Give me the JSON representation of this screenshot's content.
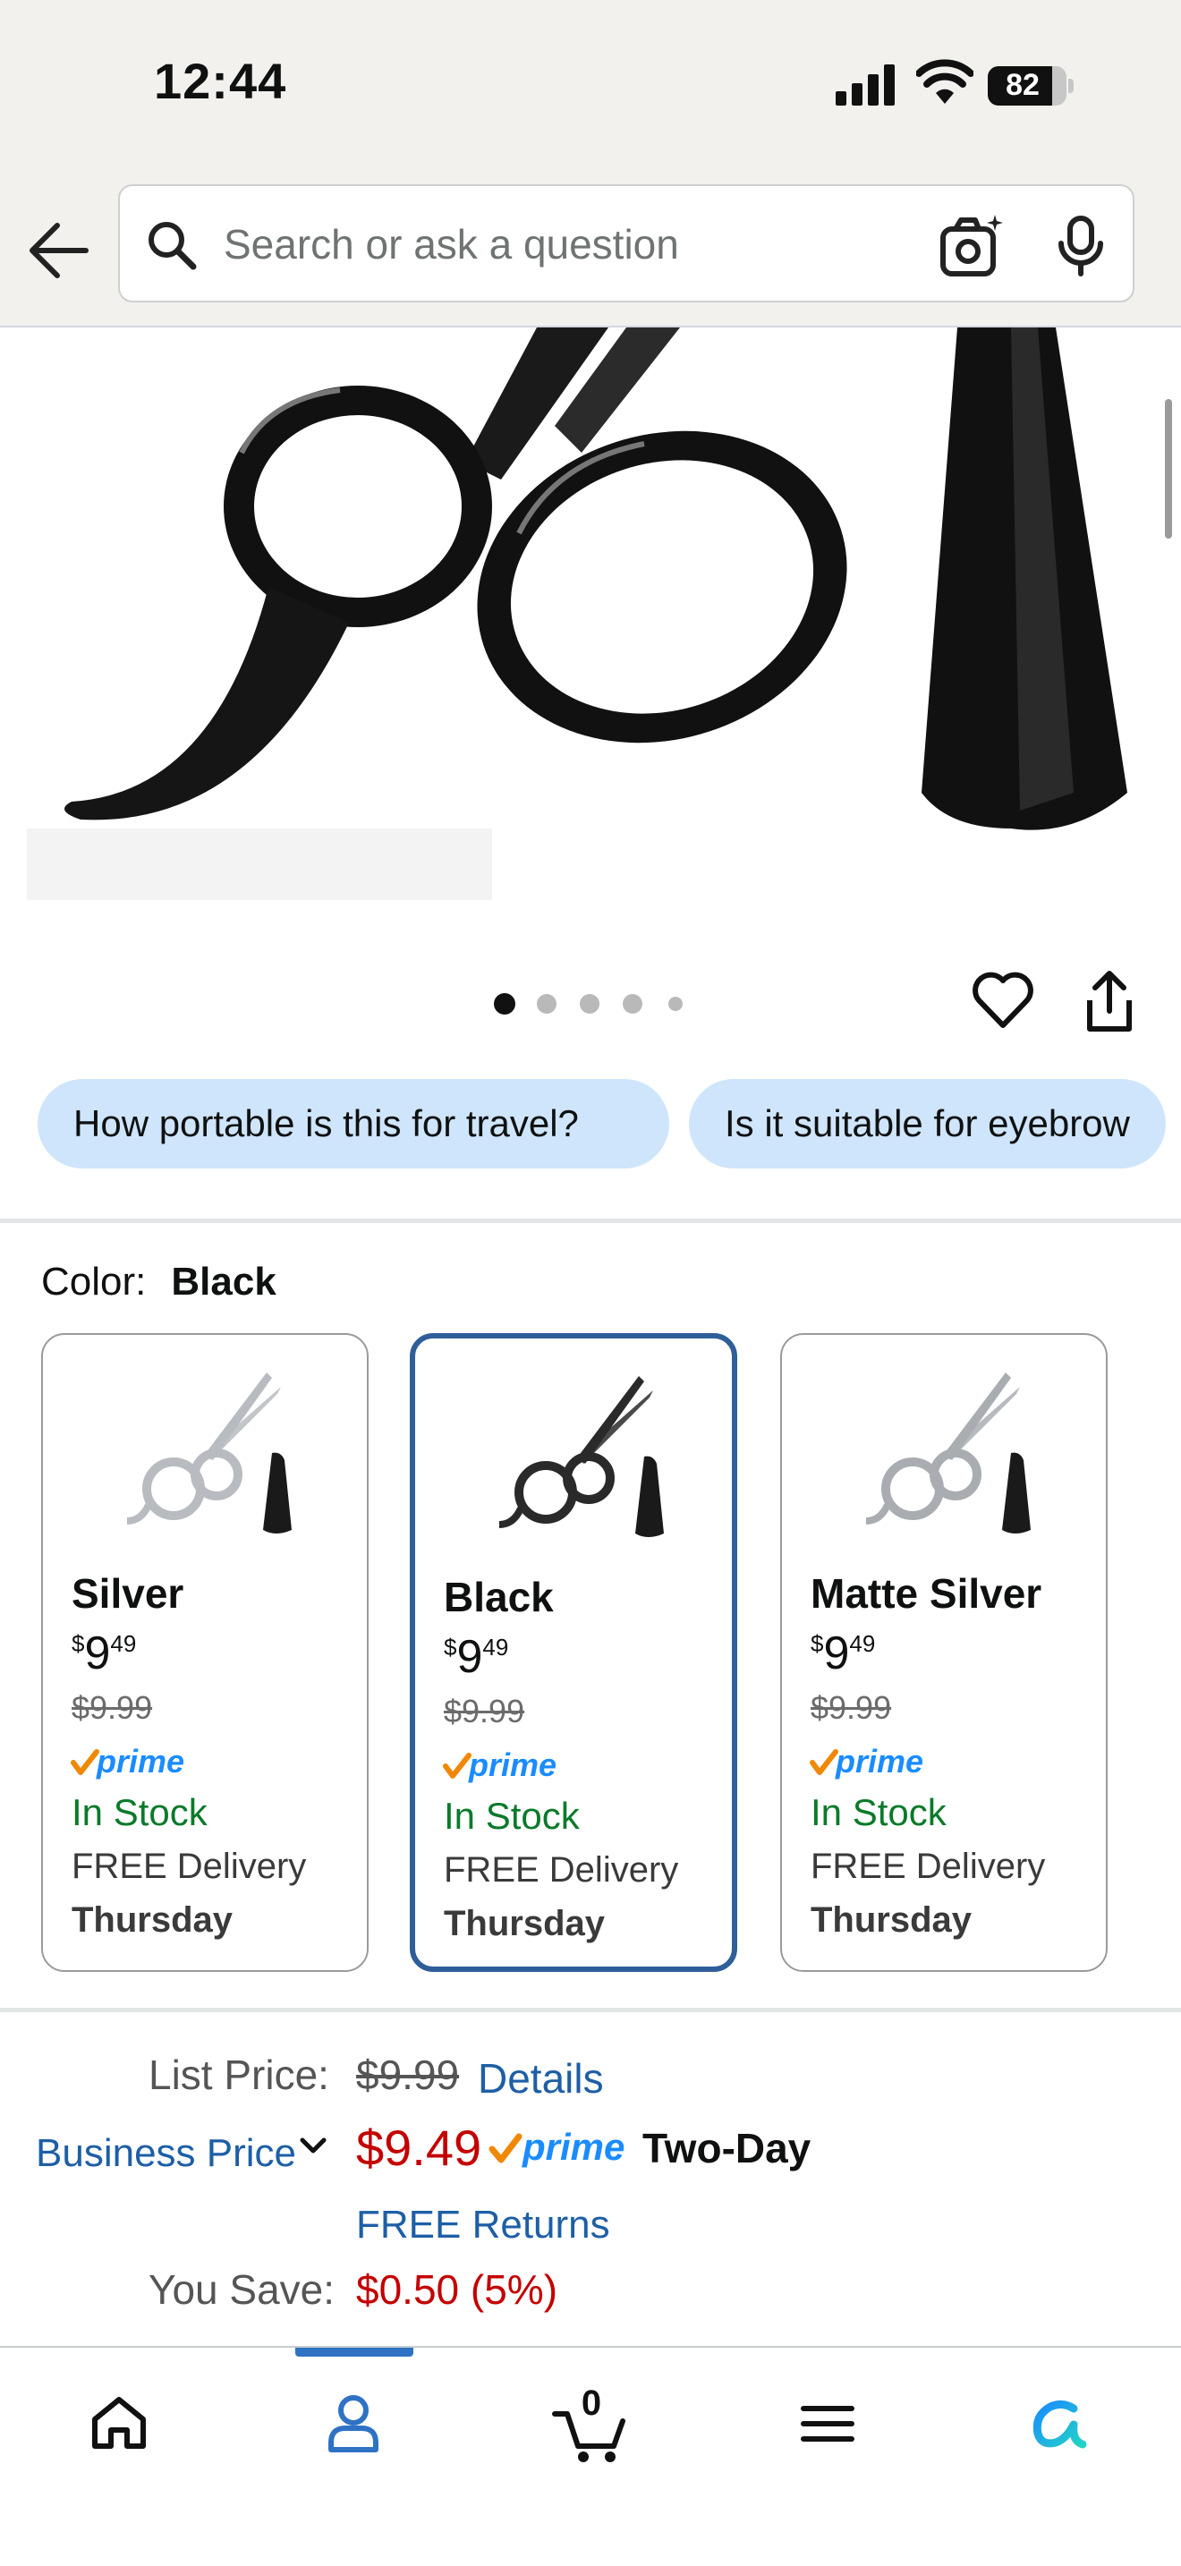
{
  "status_bar": {
    "time": "12:44",
    "battery": "82",
    "battery_level": 0.82
  },
  "search": {
    "placeholder": "Search or ask a question"
  },
  "gallery": {
    "image_count": 5,
    "active_index": 0
  },
  "questions": [
    "How portable is this for travel?",
    "Is it suitable for eyebrow"
  ],
  "color": {
    "label": "Color:",
    "selected": "Black"
  },
  "variants": [
    {
      "name": "Silver",
      "currency": "$",
      "price_whole": "9",
      "price_fraction": "49",
      "list_price": "$9.99",
      "stock": "In Stock",
      "delivery": "FREE Delivery",
      "day": "Thursday",
      "blade_color": "#b8bcc0",
      "selected": false
    },
    {
      "name": "Black",
      "currency": "$",
      "price_whole": "9",
      "price_fraction": "49",
      "list_price": "$9.99",
      "stock": "In Stock",
      "delivery": "FREE Delivery",
      "day": "Thursday",
      "blade_color": "#2a2a2a",
      "selected": true
    },
    {
      "name": "Matte Silver",
      "currency": "$",
      "price_whole": "9",
      "price_fraction": "49",
      "list_price": "$9.99",
      "stock": "In Stock",
      "delivery": "FREE Delivery",
      "day": "Thursday",
      "blade_color": "#a9adb1",
      "selected": false
    }
  ],
  "pricing": {
    "list_price_label": "List Price:",
    "list_price": "$9.99",
    "details_link": "Details",
    "business_price_label": "Business Price",
    "price": "$9.49",
    "shipping_speed": "Two-Day",
    "free_returns": "FREE Returns",
    "you_save_label": "You Save:",
    "you_save": "$0.50 (5%)"
  },
  "prime_label": "prime",
  "nav": {
    "cart_count": "0",
    "active": "account"
  },
  "colors": {
    "link": "#1d5fa6",
    "price_red": "#c40000",
    "in_stock": "#0a7a2a",
    "prime_blue": "#1a8cff",
    "check_orange": "#f08804",
    "selected_border": "#2f5f99",
    "chip_bg": "#cfe5fb"
  }
}
